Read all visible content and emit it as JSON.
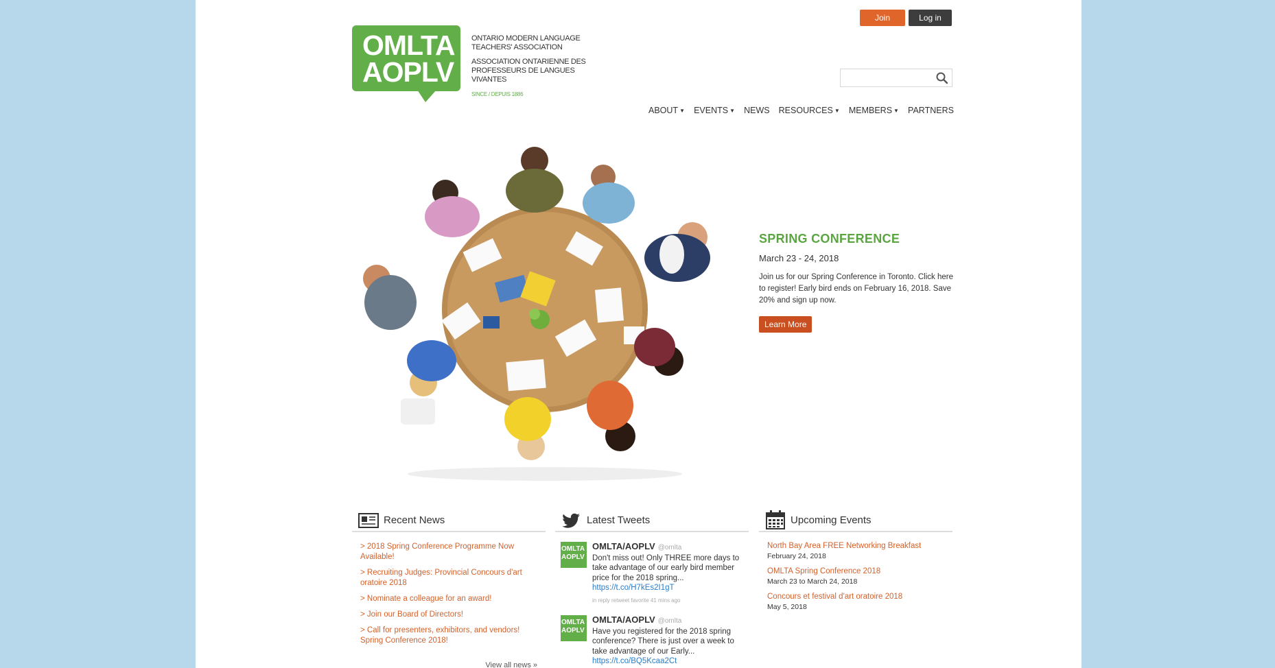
{
  "header": {
    "join_label": "Join",
    "login_label": "Log in",
    "logo_line1": "OMLTA",
    "logo_line2": "AOPLV",
    "tagline_en": "ONTARIO MODERN LANGUAGE TEACHERS' ASSOCIATION",
    "tagline_fr": "ASSOCIATION ONTARIENNE DES PROFESSEURS DE LANGUES VIVANTES",
    "since": "SINCE / DEPUIS 1886",
    "search_placeholder": ""
  },
  "nav": {
    "items": [
      {
        "label": "ABOUT",
        "dropdown": true
      },
      {
        "label": "EVENTS",
        "dropdown": true
      },
      {
        "label": "NEWS",
        "dropdown": false
      },
      {
        "label": "RESOURCES",
        "dropdown": true
      },
      {
        "label": "MEMBERS",
        "dropdown": true
      },
      {
        "label": "PARTNERS",
        "dropdown": false
      }
    ]
  },
  "promo": {
    "title": "SPRING CONFERENCE",
    "date": "March 23 - 24, 2018",
    "text": "Join us for our Spring Conference in Toronto. Click here to register! Early bird ends on February 16, 2018. Save 20% and sign up now.",
    "button": "Learn More"
  },
  "news": {
    "title": "Recent News",
    "items": [
      "> 2018 Spring Conference Programme Now Available!",
      "> Recruiting Judges: Provincial Concours d'art oratoire 2018",
      "> Nominate a colleague for an award!",
      "> Join our Board of Directors!",
      "> Call for presenters, exhibitors, and vendors! Spring Conference 2018!"
    ],
    "view_all": "View all news »"
  },
  "tweets": {
    "title": "Latest Tweets",
    "items": [
      {
        "avatar": "OMLTA AOPLV",
        "name": "OMLTA/AOPLV",
        "handle": "@omlta",
        "text": "Don't miss out! Only THREE more days to take advantage of our early bird member price for the 2018 spring...",
        "link": "https://t.co/H7kEs2I1gT",
        "meta": "in reply retweet favorite 41 mins ago"
      },
      {
        "avatar": "OMLTA AOPLV",
        "name": "OMLTA/AOPLV",
        "handle": "@omlta",
        "text": "Have you registered for the 2018 spring conference? There is just over a week to take advantage of our Early...",
        "link": "https://t.co/BQ5Kcaa2Ct",
        "meta": ""
      }
    ]
  },
  "events": {
    "title": "Upcoming Events",
    "items": [
      {
        "title": "North Bay Area FREE Networking Breakfast",
        "date": "February 24, 2018"
      },
      {
        "title": "OMLTA Spring Conference 2018",
        "date": "March 23 to March 24, 2018"
      },
      {
        "title": "Concours et festival d'art oratoire 2018",
        "date": "May 5, 2018"
      }
    ]
  },
  "colors": {
    "brand_green": "#62ae48",
    "accent_orange": "#e0652a",
    "link_orange": "#d2612a",
    "dark_button": "#3d3d3d",
    "side_background": "#b7d7ea"
  }
}
